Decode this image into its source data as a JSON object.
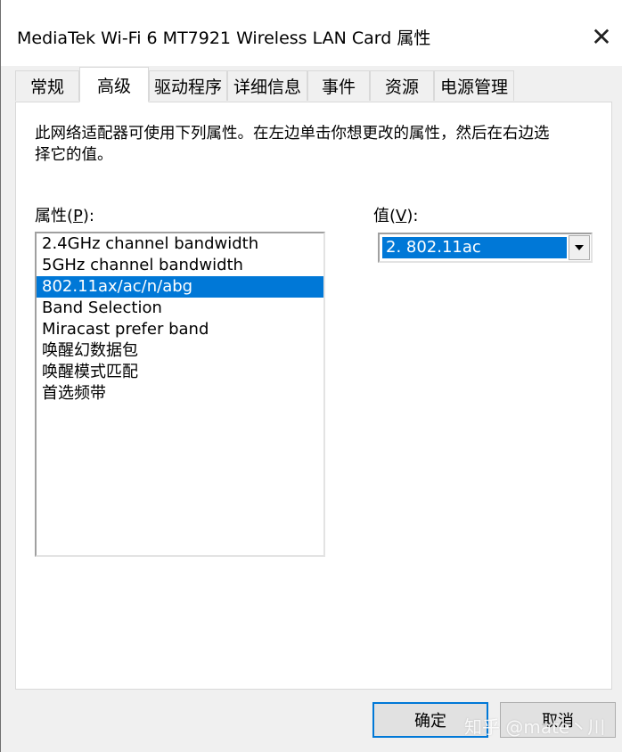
{
  "window": {
    "title": "MediaTek Wi-Fi 6 MT7921 Wireless LAN Card 属性",
    "close_glyph": "✕"
  },
  "tabs": [
    {
      "label": "常规"
    },
    {
      "label": "高级",
      "active": true
    },
    {
      "label": "驱动程序"
    },
    {
      "label": "详细信息"
    },
    {
      "label": "事件"
    },
    {
      "label": "资源"
    },
    {
      "label": "电源管理"
    }
  ],
  "description": "此网络适配器可使用下列属性。在左边单击你想更改的属性，然后在右边选择它的值。",
  "property": {
    "label_prefix": "属性(",
    "label_key": "P",
    "label_suffix": "):",
    "items": [
      "2.4GHz channel bandwidth",
      "5GHz channel bandwidth",
      "802.11ax/ac/n/abg",
      "Band Selection",
      "Miracast prefer band",
      "唤醒幻数据包",
      "唤醒模式匹配",
      "首选频带"
    ],
    "selected_index": 2
  },
  "value": {
    "label_prefix": "值(",
    "label_key": "V",
    "label_suffix": "):",
    "selected": "2. 802.11ac"
  },
  "buttons": {
    "ok": "确定",
    "cancel": "取消"
  },
  "watermark": "知乎 @mate丶川",
  "colors": {
    "selection": "#0078d7",
    "panel": "#ffffff",
    "dialog": "#f0f0f0"
  },
  "icons": [
    "close-icon",
    "dropdown-arrow-icon"
  ]
}
